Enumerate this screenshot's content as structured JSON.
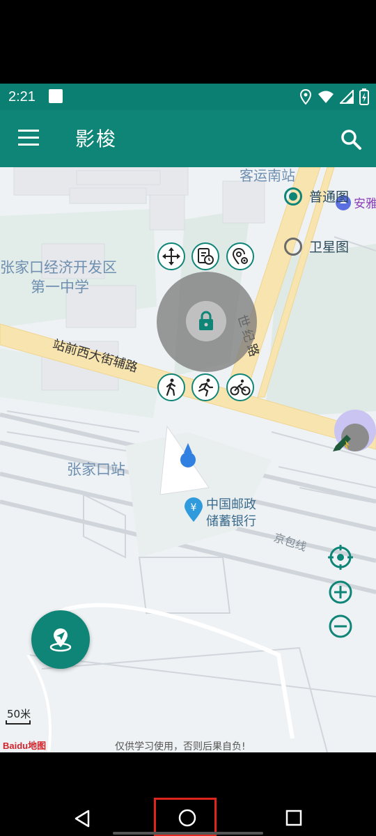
{
  "status_bar": {
    "time": "2:21"
  },
  "app_bar": {
    "title": "影梭"
  },
  "map": {
    "labels": {
      "bus_station": "客运南站",
      "dev_zone_line1": "张家口经济开发区",
      "dev_zone_line2": "第一中学",
      "road_west": "站前西大街辅路",
      "road_century": "世纪路",
      "station": "张家口站",
      "bank_line1": "中国邮政",
      "bank_line2": "储蓄银行",
      "rail_line": "京包线",
      "anya": "安雅",
      "scale": "50米",
      "disclaimer": "仅供学习使用，否则后果自负!",
      "baidu_logo": "Baidu地图"
    },
    "layer_options": [
      {
        "label": "普通图",
        "selected": true
      },
      {
        "label": "卫星图",
        "selected": false
      }
    ]
  },
  "colors": {
    "accent": "#0f8577",
    "statusbar": "#0b7f72"
  }
}
